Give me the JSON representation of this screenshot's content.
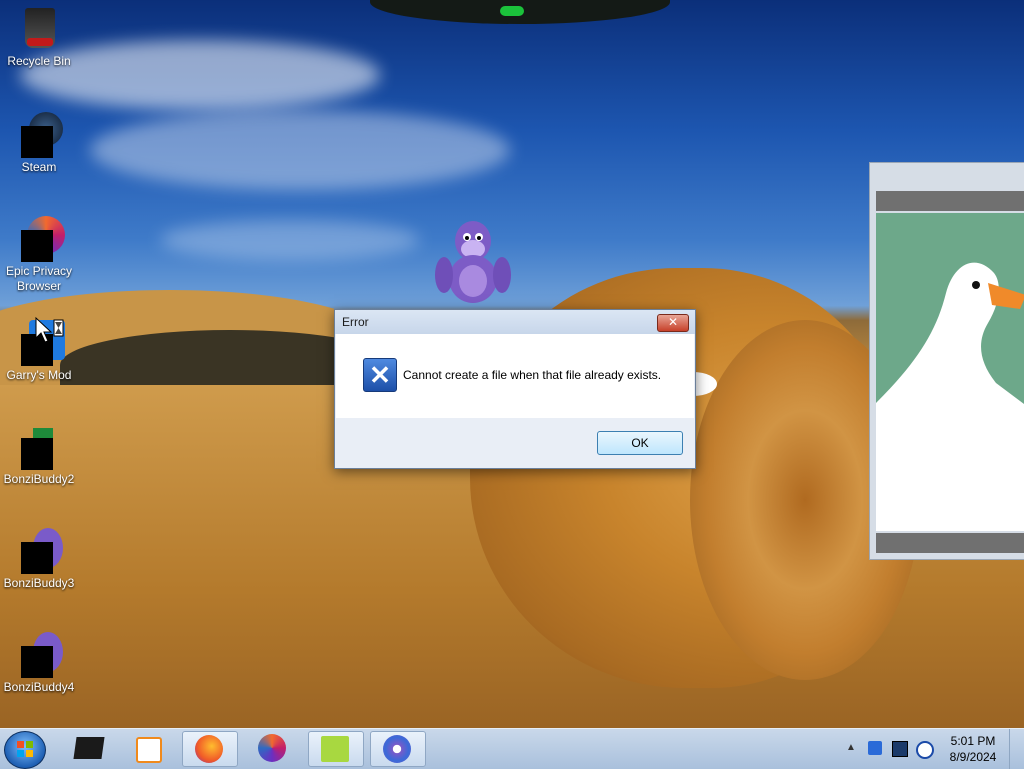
{
  "desktop_icons": [
    {
      "label": "Recycle Bin",
      "icon": "recycle-bin-icon"
    },
    {
      "label": "Steam",
      "icon": "steam-icon"
    },
    {
      "label": "Epic Privacy Browser",
      "icon": "epic-browser-icon"
    },
    {
      "label": "Garry's Mod",
      "icon": "garrys-mod-icon"
    },
    {
      "label": "BonziBuddy2",
      "icon": "bonzibuddy-icon"
    },
    {
      "label": "BonziBuddy3",
      "icon": "bonzibuddy-icon"
    },
    {
      "label": "BonziBuddy4",
      "icon": "bonzibuddy-icon"
    }
  ],
  "dialog": {
    "title": "Error",
    "close_label": "✕",
    "message": "Cannot create a file when that file already exists.",
    "ok_label": "OK",
    "icon": "error-x-icon"
  },
  "taskbar": {
    "pinned": [
      {
        "name": "explorer-icon"
      },
      {
        "name": "media-player-icon"
      },
      {
        "name": "firefox-icon"
      },
      {
        "name": "epic-browser-icon"
      },
      {
        "name": "goose-icon"
      },
      {
        "name": "bonzibuddy-icon"
      }
    ],
    "clock": {
      "time": "5:01 PM",
      "date": "8/9/2024"
    }
  },
  "colors": {
    "accent": "#3c7fb1",
    "close_red": "#c7412a",
    "taskbar": "#b9cde5"
  }
}
